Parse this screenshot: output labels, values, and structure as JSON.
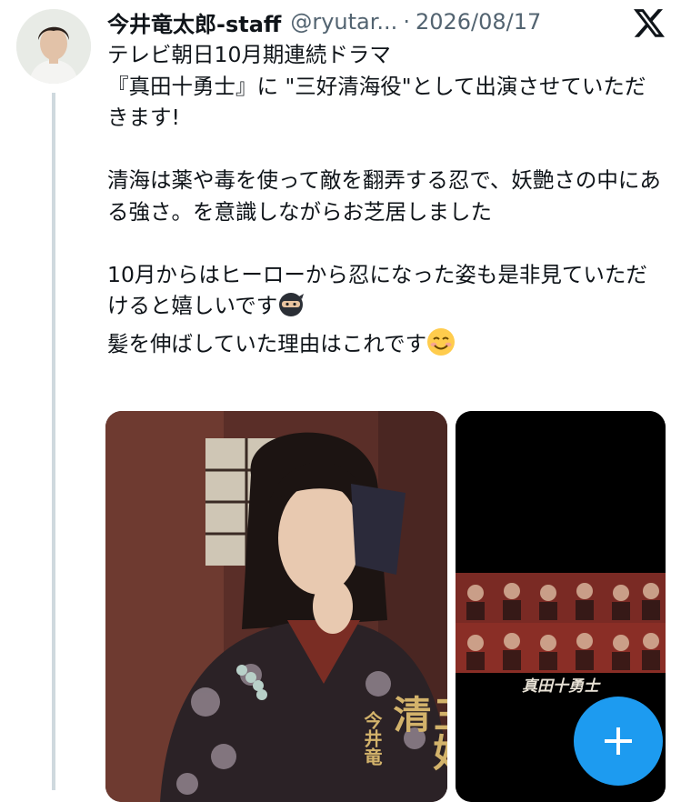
{
  "post": {
    "author_name": "今井竜太郎-staff",
    "handle": "@ryutar...",
    "separator": "·",
    "date": "2026/08/17",
    "text_main": "テレビ朝日10月期連続ドラマ\n『真田十勇士』に \"三好清海役\"として出演させていただきます!\n\n清海は薬や毒を使って敵を翻弄する忍で、妖艶さの中にある強さ。を意識しながらお芝居しました\n\n10月からはヒーローから忍になった姿も是非見ていただけると嬉しいです",
    "text_last": "髪を伸ばしていた理由はこれです"
  },
  "icons": {
    "platform": "x-logo-icon",
    "ninja": "ninja-emoji-icon",
    "smile": "smiling-face-emoji-icon",
    "compose": "plus-icon"
  },
  "media": {
    "poster_vertical_title": "三好清",
    "poster_vertical_name": "今井竜",
    "cast_logo": "真田十勇士"
  },
  "colors": {
    "accent": "#1d9bf0",
    "text": "#0f1419",
    "muted": "#536471"
  }
}
